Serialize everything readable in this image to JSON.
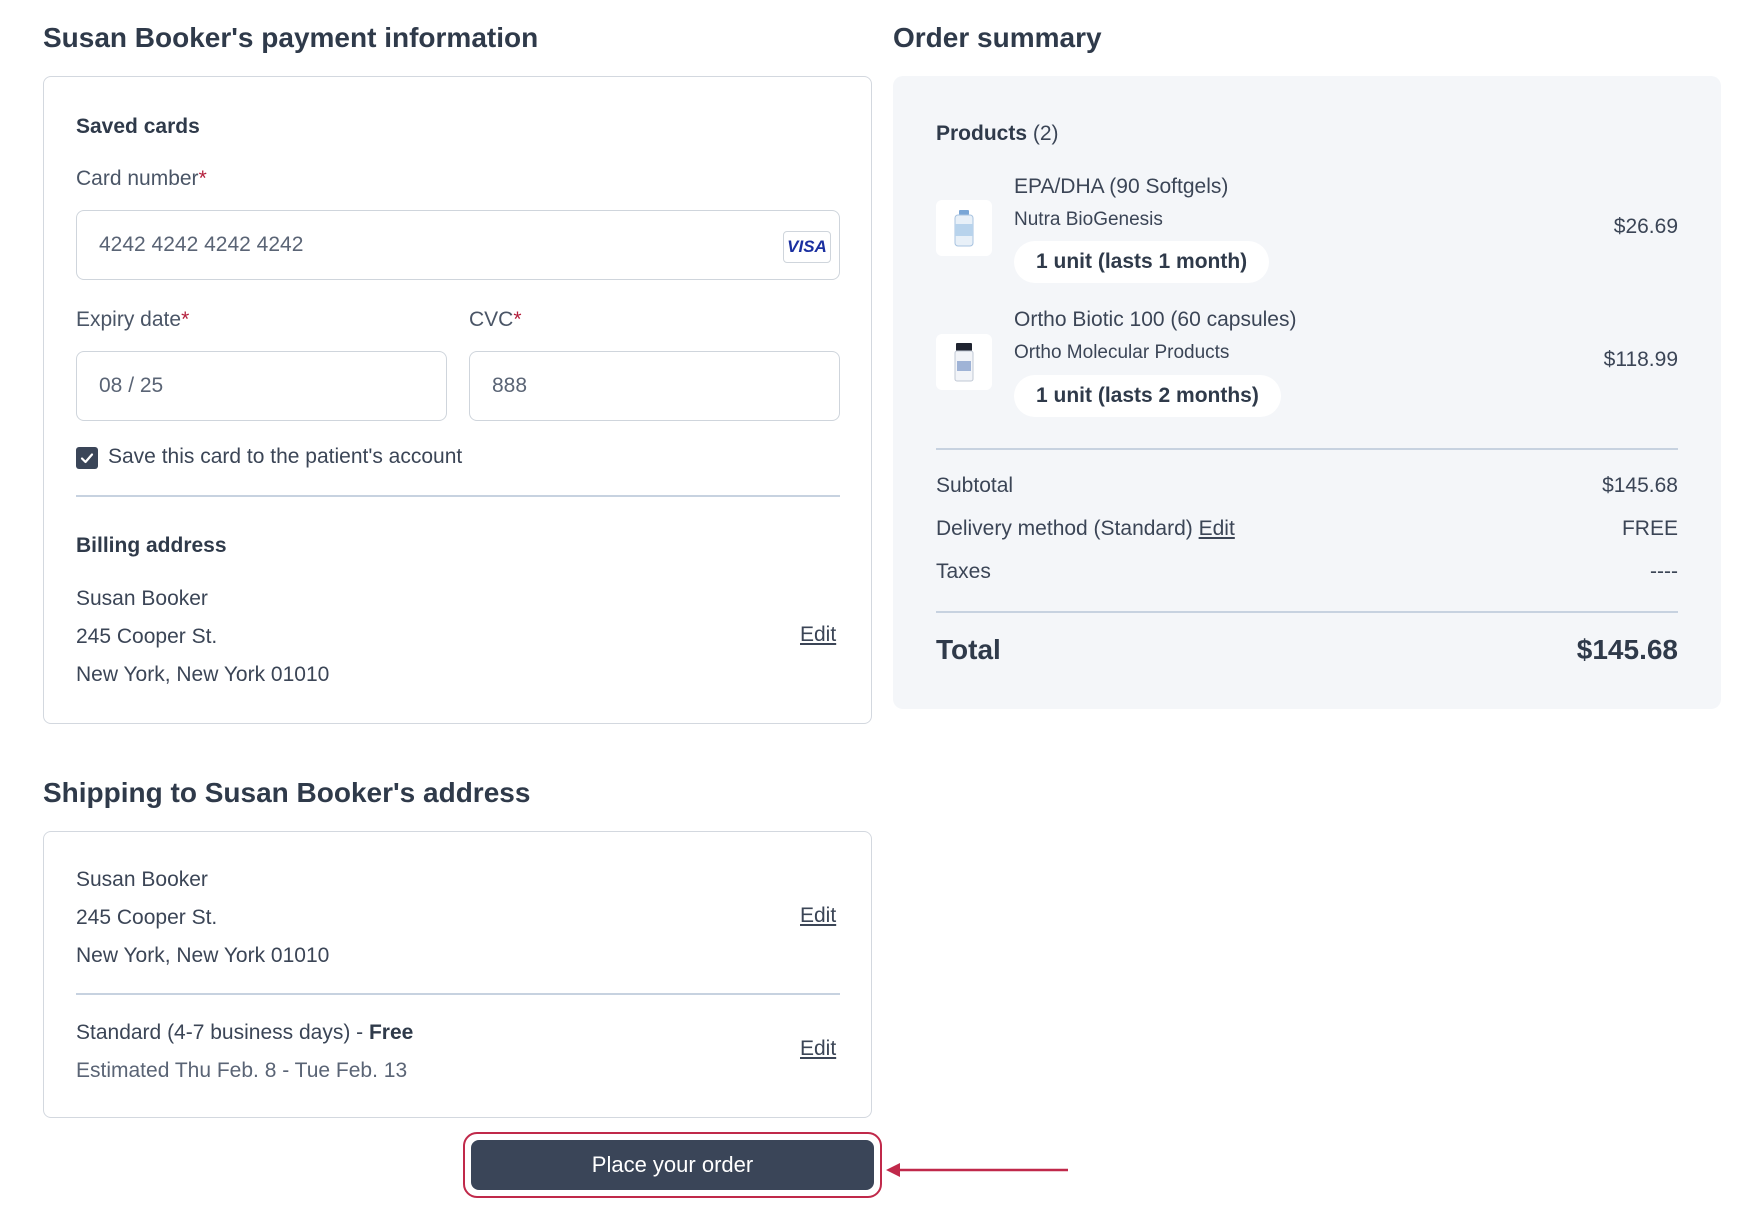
{
  "payment": {
    "title": "Susan Booker's payment information",
    "saved_cards_label": "Saved cards",
    "card_number_label": "Card number",
    "required_mark": "*",
    "card_number_value": "4242 4242 4242 4242",
    "card_brand": "VISA",
    "expiry_label": "Expiry date",
    "expiry_value": "08 / 25",
    "cvc_label": "CVC",
    "cvc_value": "888",
    "save_card_label": "Save this card to the patient's account",
    "save_card_checked": true,
    "billing_label": "Billing address",
    "billing_name": "Susan Booker",
    "billing_street": "245 Cooper St.",
    "billing_city": "New York, New York 01010",
    "billing_edit": "Edit"
  },
  "shipping": {
    "title": "Shipping to Susan Booker's address",
    "name": "Susan Booker",
    "street": "245 Cooper St.",
    "city": "New York, New York 01010",
    "address_edit": "Edit",
    "method_text": "Standard (4-7 business days) - ",
    "method_price": "Free",
    "estimate": "Estimated Thu Feb. 8 - Tue Feb. 13",
    "method_edit": "Edit"
  },
  "summary": {
    "title": "Order summary",
    "products_label": "Products",
    "products_count": "(2)",
    "products": [
      {
        "name": "EPA/DHA (90 Softgels)",
        "brand": "Nutra BioGenesis",
        "quantity": "1 unit (lasts 1 month)",
        "price": "$26.69"
      },
      {
        "name": "Ortho Biotic 100 (60 capsules)",
        "brand": "Ortho Molecular Products",
        "quantity": "1 unit (lasts 2 months)",
        "price": "$118.99"
      }
    ],
    "subtotal_label": "Subtotal",
    "subtotal_value": "$145.68",
    "delivery_label": "Delivery method (Standard)",
    "delivery_edit": "Edit",
    "delivery_value": "FREE",
    "taxes_label": "Taxes",
    "taxes_value": "----",
    "total_label": "Total",
    "total_value": "$145.68"
  },
  "actions": {
    "place_order": "Place your order"
  },
  "colors": {
    "primary_button": "#3a4558",
    "highlight": "#c0294a",
    "summary_bg": "#f4f6f9"
  }
}
